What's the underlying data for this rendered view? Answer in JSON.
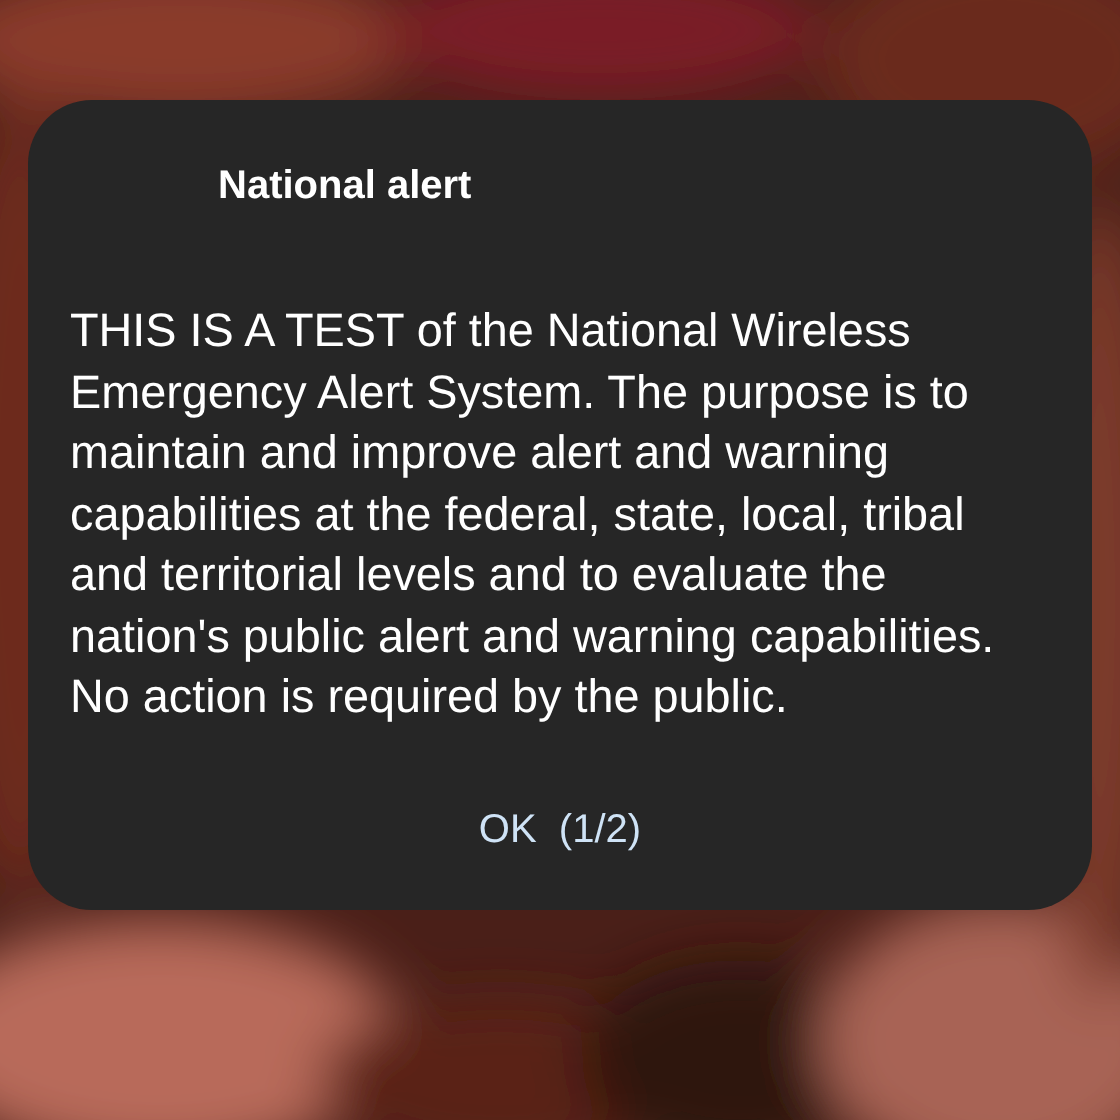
{
  "dialog": {
    "title": "National alert",
    "message": "THIS IS A TEST of the National Wireless Emergency Alert System. The purpose is to maintain and improve alert and warning capabilities at the federal, state, local, tribal and territorial levels and to evaluate the nation's public alert and warning capabilities. No action is required by the public.",
    "buttons": [
      "OK  (1/2)"
    ]
  }
}
